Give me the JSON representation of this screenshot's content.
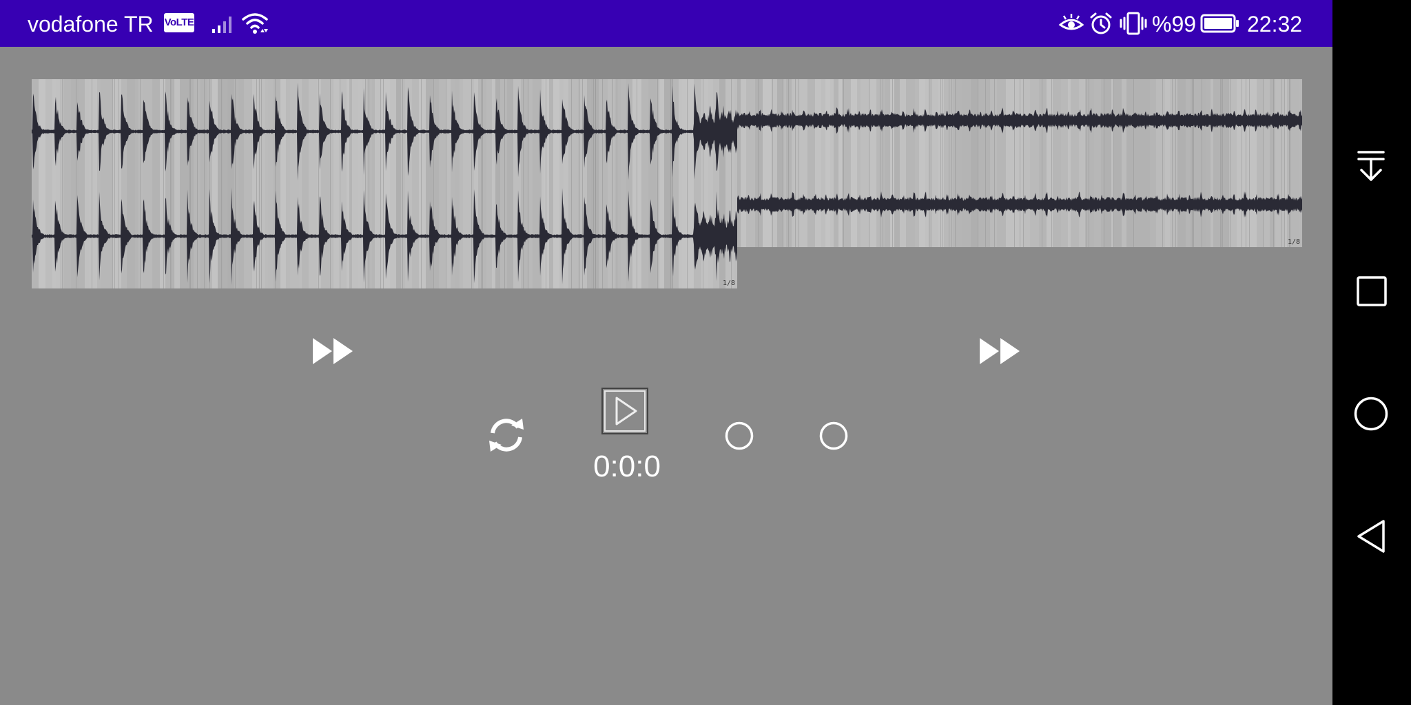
{
  "status_bar": {
    "carrier": "vodafone TR",
    "volte": "VoLTE",
    "icons": [
      "signal-icon",
      "wifi-icon",
      "eye-comfort-icon",
      "alarm-icon",
      "vibrate-icon",
      "battery-icon"
    ],
    "battery_percent": "%99",
    "time": "22:32",
    "background": "#3700b3"
  },
  "waveforms": {
    "track1": {
      "page_indicator": "1/8"
    },
    "track2": {
      "page_indicator": "1/8"
    },
    "colors": {
      "wave": "#2a2a35",
      "background": "#b8b8b8"
    }
  },
  "controls": {
    "time": "0:0:0",
    "buttons": [
      "fast-forward-left",
      "fast-forward-right",
      "loop",
      "play",
      "option-circle-1",
      "option-circle-2"
    ]
  },
  "nav_bar": {
    "buttons": [
      "notification-pulldown",
      "recent-apps",
      "home",
      "back"
    ]
  }
}
